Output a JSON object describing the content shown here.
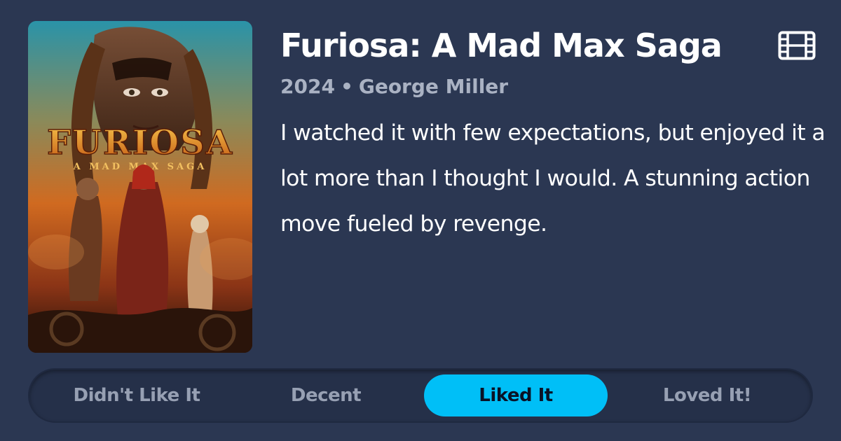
{
  "movie": {
    "title": "Furiosa: A Mad Max Saga",
    "year": "2024",
    "separator": "•",
    "director": "George Miller",
    "review": "I watched it with few expectations, but enjoyed it a lot more than I thought I would. A stunning action move fueled by revenge.",
    "type_icon": "film-icon"
  },
  "poster": {
    "logo_title": "FURIOSA",
    "logo_subtitle": "A MAD MAX SAGA"
  },
  "rating": {
    "options": [
      "Didn't Like It",
      "Decent",
      "Liked It",
      "Loved It!"
    ],
    "selected": "Liked It"
  },
  "colors": {
    "background": "#2b3752",
    "accent": "#00bff7",
    "muted_text": "#aab2c3",
    "option_text": "#97a0b3"
  }
}
